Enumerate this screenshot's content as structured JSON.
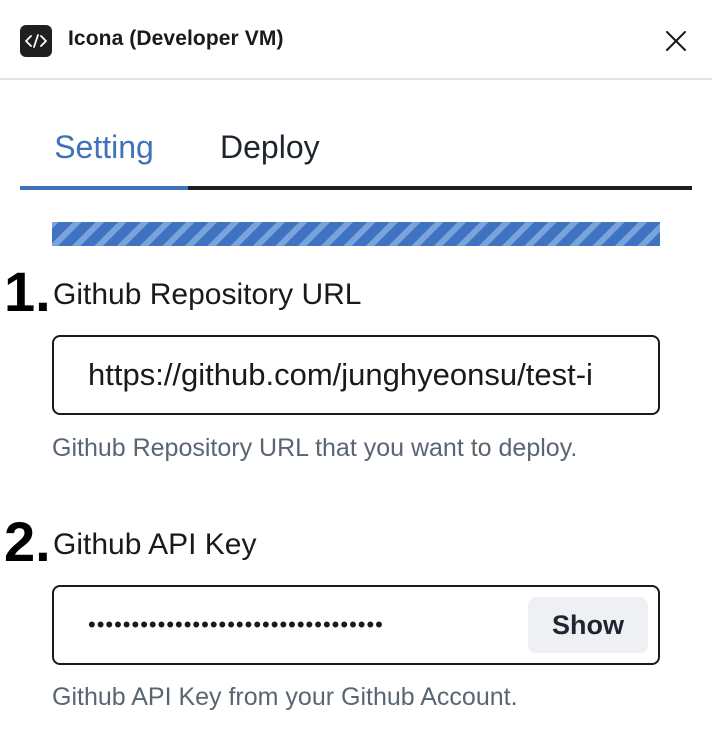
{
  "window": {
    "title": "Icona (Developer VM)",
    "app_icon": "code-icon",
    "close_icon": "close-icon"
  },
  "tabs": [
    {
      "label": "Setting",
      "active": true
    },
    {
      "label": "Deploy",
      "active": false
    }
  ],
  "progress": {
    "style": "striped",
    "color": "#3f72c0"
  },
  "fields": [
    {
      "number": "1.",
      "label": "Github Repository URL",
      "value": "https://github.com/junghyeonsu/test-i",
      "help": "Github Repository URL that you want to deploy."
    },
    {
      "number": "2.",
      "label": "Github API Key",
      "value": "••••••••••••••••••••••••••••••••••",
      "action_label": "Show",
      "help": "Github API Key from your Github Account."
    }
  ],
  "colors": {
    "accent": "#3f72b8",
    "text": "#1a1a1a",
    "muted": "#5a6573"
  }
}
